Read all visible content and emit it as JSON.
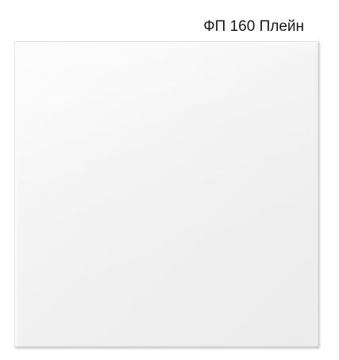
{
  "product": {
    "title": "ФП 160 Плейн"
  }
}
